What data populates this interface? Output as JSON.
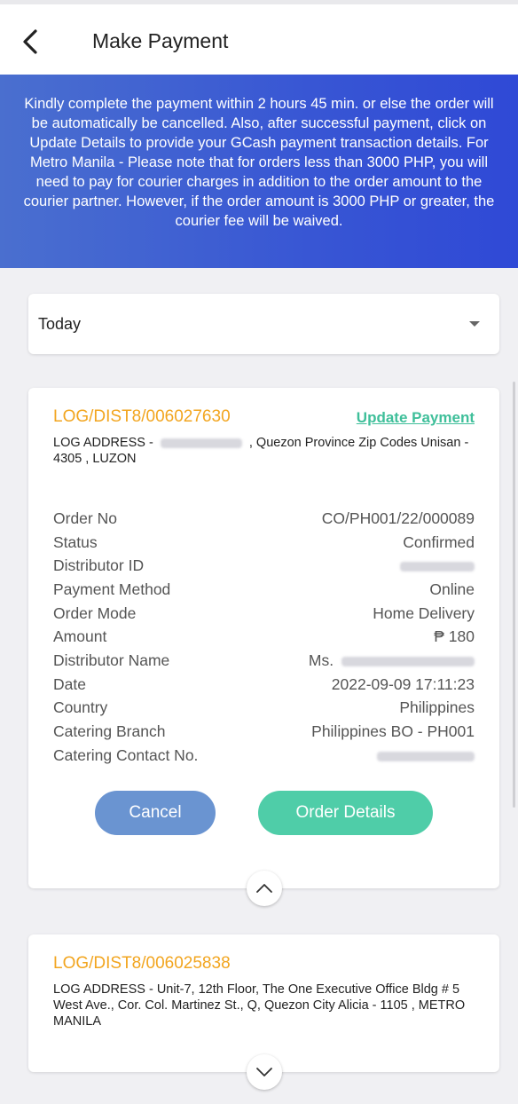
{
  "header": {
    "title": "Make Payment"
  },
  "banner": {
    "text": "Kindly complete the payment within 2 hours 45 min. or else the order will be automatically be cancelled. Also, after successful payment, click on Update Details to provide your GCash payment transaction details. For Metro Manila - Please note that for orders less than 3000 PHP, you will need to pay for courier charges in addition to the order amount to the courier partner. However, if the order amount is 3000 PHP or greater, the courier fee will be waived."
  },
  "filter": {
    "selected": "Today"
  },
  "orders": [
    {
      "id": "LOG/DIST8/006027630",
      "update_label": "Update Payment",
      "address_prefix": "LOG ADDRESS -",
      "address_suffix": ", Quezon Province Zip Codes Unisan - 4305  , LUZON",
      "details": [
        {
          "label": "Order No",
          "value": "CO/PH001/22/000089"
        },
        {
          "label": "Status",
          "value": "Confirmed"
        },
        {
          "label": "Distributor ID",
          "value": ""
        },
        {
          "label": "Payment Method",
          "value": "Online"
        },
        {
          "label": "Order Mode",
          "value": "Home Delivery"
        },
        {
          "label": "Amount",
          "value": "₱ 180"
        },
        {
          "label": "Distributor Name",
          "value": "Ms."
        },
        {
          "label": "Date",
          "value": "2022-09-09 17:11:23"
        },
        {
          "label": "Country",
          "value": "Philippines"
        },
        {
          "label": "Catering Branch",
          "value": "Philippines BO - PH001"
        },
        {
          "label": "Catering Contact No.",
          "value": ""
        }
      ],
      "cancel_label": "Cancel",
      "details_label": "Order Details"
    },
    {
      "id": "LOG/DIST8/006025838",
      "address": "LOG ADDRESS - Unit-7, 12th Floor, The One Executive Office Bldg # 5 West Ave., Cor. Col. Martinez St., Q, Quezon City  Alicia - 1105  , METRO MANILA"
    }
  ],
  "icons": {
    "back": "chevron-left-icon",
    "dropdown": "caret-down-icon",
    "collapse": "chevron-up-icon",
    "expand": "chevron-down-icon"
  },
  "colors": {
    "banner": "#3856d4",
    "order_id": "#f2a51f",
    "update_link": "#3fbf9a",
    "cancel_button": "#6a94d1",
    "details_button": "#4fcda8"
  }
}
